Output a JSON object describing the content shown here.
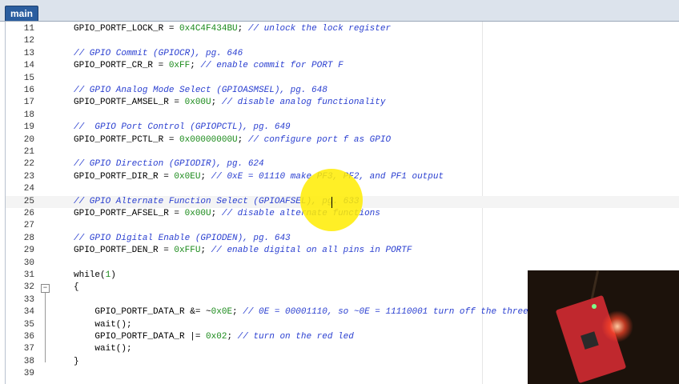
{
  "tab": {
    "label": "main"
  },
  "lines": [
    {
      "n": "11",
      "segs": [
        [
          "t",
          "GPIO_PORTF_LOCK_R = "
        ],
        [
          "n",
          "0x4C4F434BU"
        ],
        [
          "t",
          "; "
        ],
        [
          "c",
          "// unlock the lock register"
        ]
      ]
    },
    {
      "n": "12",
      "segs": []
    },
    {
      "n": "13",
      "segs": [
        [
          "c",
          "// GPIO Commit (GPIOCR), pg. 646"
        ]
      ]
    },
    {
      "n": "14",
      "segs": [
        [
          "t",
          "GPIO_PORTF_CR_R = "
        ],
        [
          "n",
          "0xFF"
        ],
        [
          "t",
          "; "
        ],
        [
          "c",
          "// enable commit for PORT F"
        ]
      ]
    },
    {
      "n": "15",
      "segs": []
    },
    {
      "n": "16",
      "segs": [
        [
          "c",
          "// GPIO Analog Mode Select (GPIOASMSEL), pg. 648"
        ]
      ]
    },
    {
      "n": "17",
      "segs": [
        [
          "t",
          "GPIO_PORTF_AMSEL_R = "
        ],
        [
          "n",
          "0x00U"
        ],
        [
          "t",
          "; "
        ],
        [
          "c",
          "// disable analog functionality"
        ]
      ]
    },
    {
      "n": "18",
      "segs": []
    },
    {
      "n": "19",
      "segs": [
        [
          "c",
          "//  GPIO Port Control (GPIOPCTL), pg. 649"
        ]
      ]
    },
    {
      "n": "20",
      "segs": [
        [
          "t",
          "GPIO_PORTF_PCTL_R = "
        ],
        [
          "n",
          "0x00000000U"
        ],
        [
          "t",
          "; "
        ],
        [
          "c",
          "// configure port f as GPIO"
        ]
      ]
    },
    {
      "n": "21",
      "segs": []
    },
    {
      "n": "22",
      "segs": [
        [
          "c",
          "// GPIO Direction (GPIODIR), pg. 624"
        ]
      ]
    },
    {
      "n": "23",
      "segs": [
        [
          "t",
          "GPIO_PORTF_DIR_R = "
        ],
        [
          "n",
          "0x0EU"
        ],
        [
          "t",
          "; "
        ],
        [
          "c",
          "// 0xE = 01110 make PF3, PF2, and PF1 output"
        ]
      ]
    },
    {
      "n": "24",
      "segs": []
    },
    {
      "n": "25",
      "segs": [
        [
          "c",
          "// GPIO Alternate Function Select (GPIOAFSEL), pg. 633"
        ]
      ]
    },
    {
      "n": "26",
      "segs": [
        [
          "t",
          "GPIO_PORTF_AFSEL_R = "
        ],
        [
          "n",
          "0x00U"
        ],
        [
          "t",
          "; "
        ],
        [
          "c",
          "// disable alternate functions"
        ]
      ]
    },
    {
      "n": "27",
      "segs": []
    },
    {
      "n": "28",
      "segs": [
        [
          "c",
          "// GPIO Digital Enable (GPIODEN), pg. 643"
        ]
      ]
    },
    {
      "n": "29",
      "segs": [
        [
          "t",
          "GPIO_PORTF_DEN_R = "
        ],
        [
          "n",
          "0xFFU"
        ],
        [
          "t",
          "; "
        ],
        [
          "c",
          "// enable digital on all pins in PORTF"
        ]
      ]
    },
    {
      "n": "30",
      "segs": []
    },
    {
      "n": "31",
      "segs": [
        [
          "t",
          "while("
        ],
        [
          "n",
          "1"
        ],
        [
          "t",
          ")"
        ]
      ]
    },
    {
      "n": "32",
      "segs": [
        [
          "t",
          "{"
        ]
      ]
    },
    {
      "n": "33",
      "segs": []
    },
    {
      "n": "34",
      "segs": [
        [
          "t",
          "    GPIO_PORTF_DATA_R &= ~"
        ],
        [
          "n",
          "0x0E"
        ],
        [
          "t",
          "; "
        ],
        [
          "c",
          "// 0E = 00001110, so ~0E = 11110001 turn off the three"
        ]
      ]
    },
    {
      "n": "35",
      "segs": [
        [
          "t",
          "    wait();"
        ]
      ]
    },
    {
      "n": "36",
      "segs": [
        [
          "t",
          "    GPIO_PORTF_DATA_R |= "
        ],
        [
          "n",
          "0x02"
        ],
        [
          "t",
          "; "
        ],
        [
          "c",
          "// turn on the red led"
        ]
      ]
    },
    {
      "n": "37",
      "segs": [
        [
          "t",
          "    wait();"
        ]
      ]
    },
    {
      "n": "38",
      "segs": [
        [
          "t",
          "}"
        ]
      ]
    },
    {
      "n": "39",
      "segs": []
    }
  ],
  "fold": {
    "line": "32",
    "symbol": "−"
  },
  "colors": {
    "comment": "#2a3fd0",
    "number": "#1a8a1a",
    "tab": "#2a5d9f",
    "highlight": "#ffec00"
  }
}
